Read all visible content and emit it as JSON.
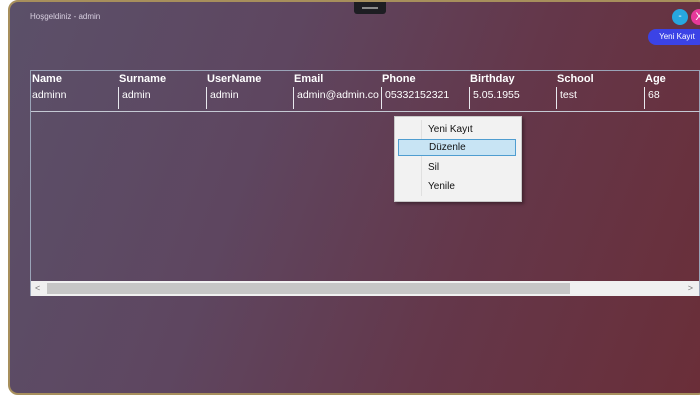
{
  "window": {
    "welcome": "Hoşgeldiniz - admin",
    "minimize_label": "-",
    "close_label": "X",
    "new_record_label": "Yeni Kayıt"
  },
  "grid": {
    "columns": [
      "Name",
      "Surname",
      "UserName",
      "Email",
      "Phone",
      "Birthday",
      "School",
      "Age"
    ],
    "rows": [
      [
        "adminn",
        "admin",
        "admin",
        "admin@admin.co",
        "05332152321",
        "5.05.1955",
        "test",
        "68"
      ]
    ],
    "scroll_left": "<",
    "scroll_right": ">"
  },
  "context_menu": {
    "items": [
      "Yeni Kayıt",
      "Düzenle",
      "Sil",
      "Yenile"
    ],
    "hovered": "Düzenle"
  },
  "colors": {
    "accent_blue": "#3b43e6",
    "minimize": "#27a7e0",
    "close": "#e6399b"
  }
}
